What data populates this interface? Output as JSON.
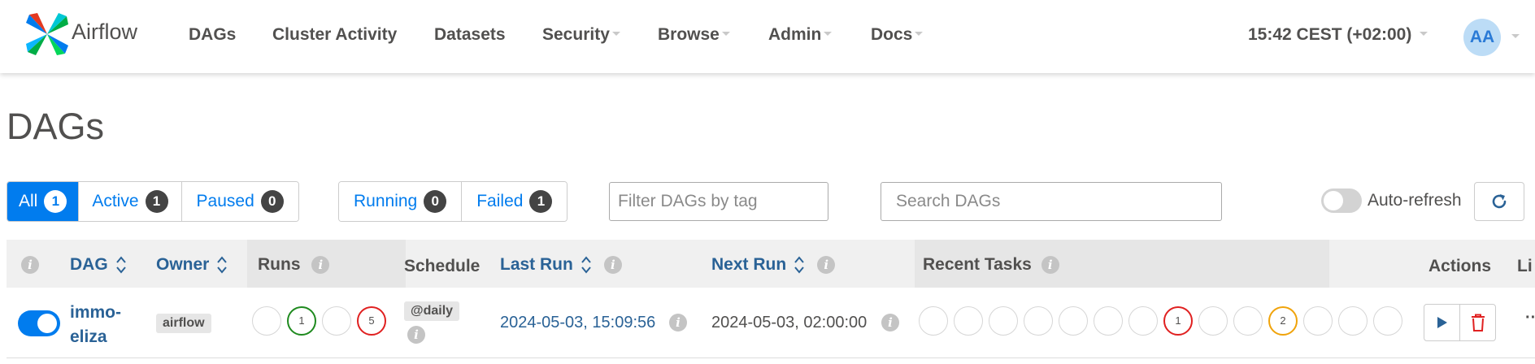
{
  "app": {
    "brand": "Airflow"
  },
  "nav": {
    "dags": "DAGs",
    "cluster_activity": "Cluster Activity",
    "datasets": "Datasets",
    "security": "Security",
    "browse": "Browse",
    "admin": "Admin",
    "docs": "Docs"
  },
  "header": {
    "clock": "15:42 CEST (+02:00)",
    "avatar_initials": "AA"
  },
  "page": {
    "title": "DAGs"
  },
  "filters": {
    "all": {
      "label": "All",
      "count": "1"
    },
    "active": {
      "label": "Active",
      "count": "1"
    },
    "paused": {
      "label": "Paused",
      "count": "0"
    },
    "running": {
      "label": "Running",
      "count": "0"
    },
    "failed": {
      "label": "Failed",
      "count": "1"
    }
  },
  "search": {
    "tag_placeholder": "Filter DAGs by tag",
    "dag_placeholder": "Search DAGs"
  },
  "auto_refresh": {
    "label": "Auto-refresh",
    "enabled": false
  },
  "table": {
    "headers": {
      "dag": "DAG",
      "owner": "Owner",
      "runs": "Runs",
      "schedule": "Schedule",
      "last_run": "Last Run",
      "next_run": "Next Run",
      "recent_tasks": "Recent Tasks",
      "actions": "Actions",
      "links": "Li"
    },
    "rows": [
      {
        "dag_id": "immo-eliza",
        "paused": false,
        "owner": "airflow",
        "runs": [
          "",
          "1",
          "",
          "5"
        ],
        "schedule": "@daily",
        "last_run": "2024-05-03, 15:09:56",
        "next_run": "2024-05-03, 02:00:00",
        "recent_tasks": [
          "",
          "",
          "",
          "",
          "",
          "",
          "",
          "1",
          "",
          "",
          "2",
          "",
          "",
          ""
        ]
      }
    ]
  },
  "colors": {
    "accent": "#017cee",
    "link": "#2a6296",
    "success": "#1f8a1f",
    "failed": "#e02020",
    "upstream_failed": "#f0a30a"
  }
}
